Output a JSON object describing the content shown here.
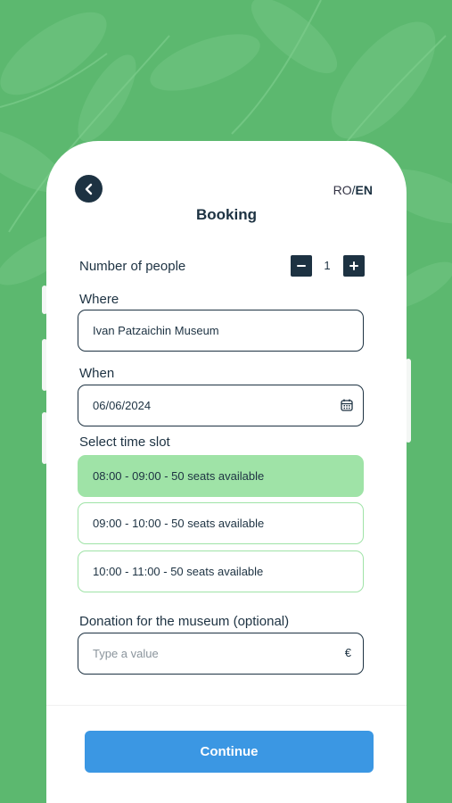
{
  "header": {
    "title": "Booking",
    "lang_inactive": "RO",
    "lang_separator": "/",
    "lang_active": "EN",
    "back_icon": "chevron-left-icon"
  },
  "people": {
    "label": "Number of people",
    "count": "1",
    "minus_icon": "minus-icon",
    "plus_icon": "plus-icon"
  },
  "where": {
    "label": "Where",
    "value": "Ivan Patzaichin Museum"
  },
  "when": {
    "label": "When",
    "value": "06/06/2024",
    "icon": "calendar-icon"
  },
  "time_slots": {
    "label": "Select time slot",
    "items": [
      {
        "label": "08:00 - 09:00 - 50 seats available",
        "selected": true
      },
      {
        "label": "09:00 - 10:00 - 50 seats available",
        "selected": false
      },
      {
        "label": "10:00 - 11:00 - 50 seats available",
        "selected": false
      }
    ]
  },
  "donation": {
    "label": "Donation for the museum (optional)",
    "placeholder": "Type a value",
    "currency": "€"
  },
  "footer": {
    "continue_label": "Continue"
  },
  "colors": {
    "background_green": "#5cb86f",
    "dark_navy": "#1d3242",
    "slot_green": "#9fe3a7",
    "button_blue": "#3b97e3"
  }
}
